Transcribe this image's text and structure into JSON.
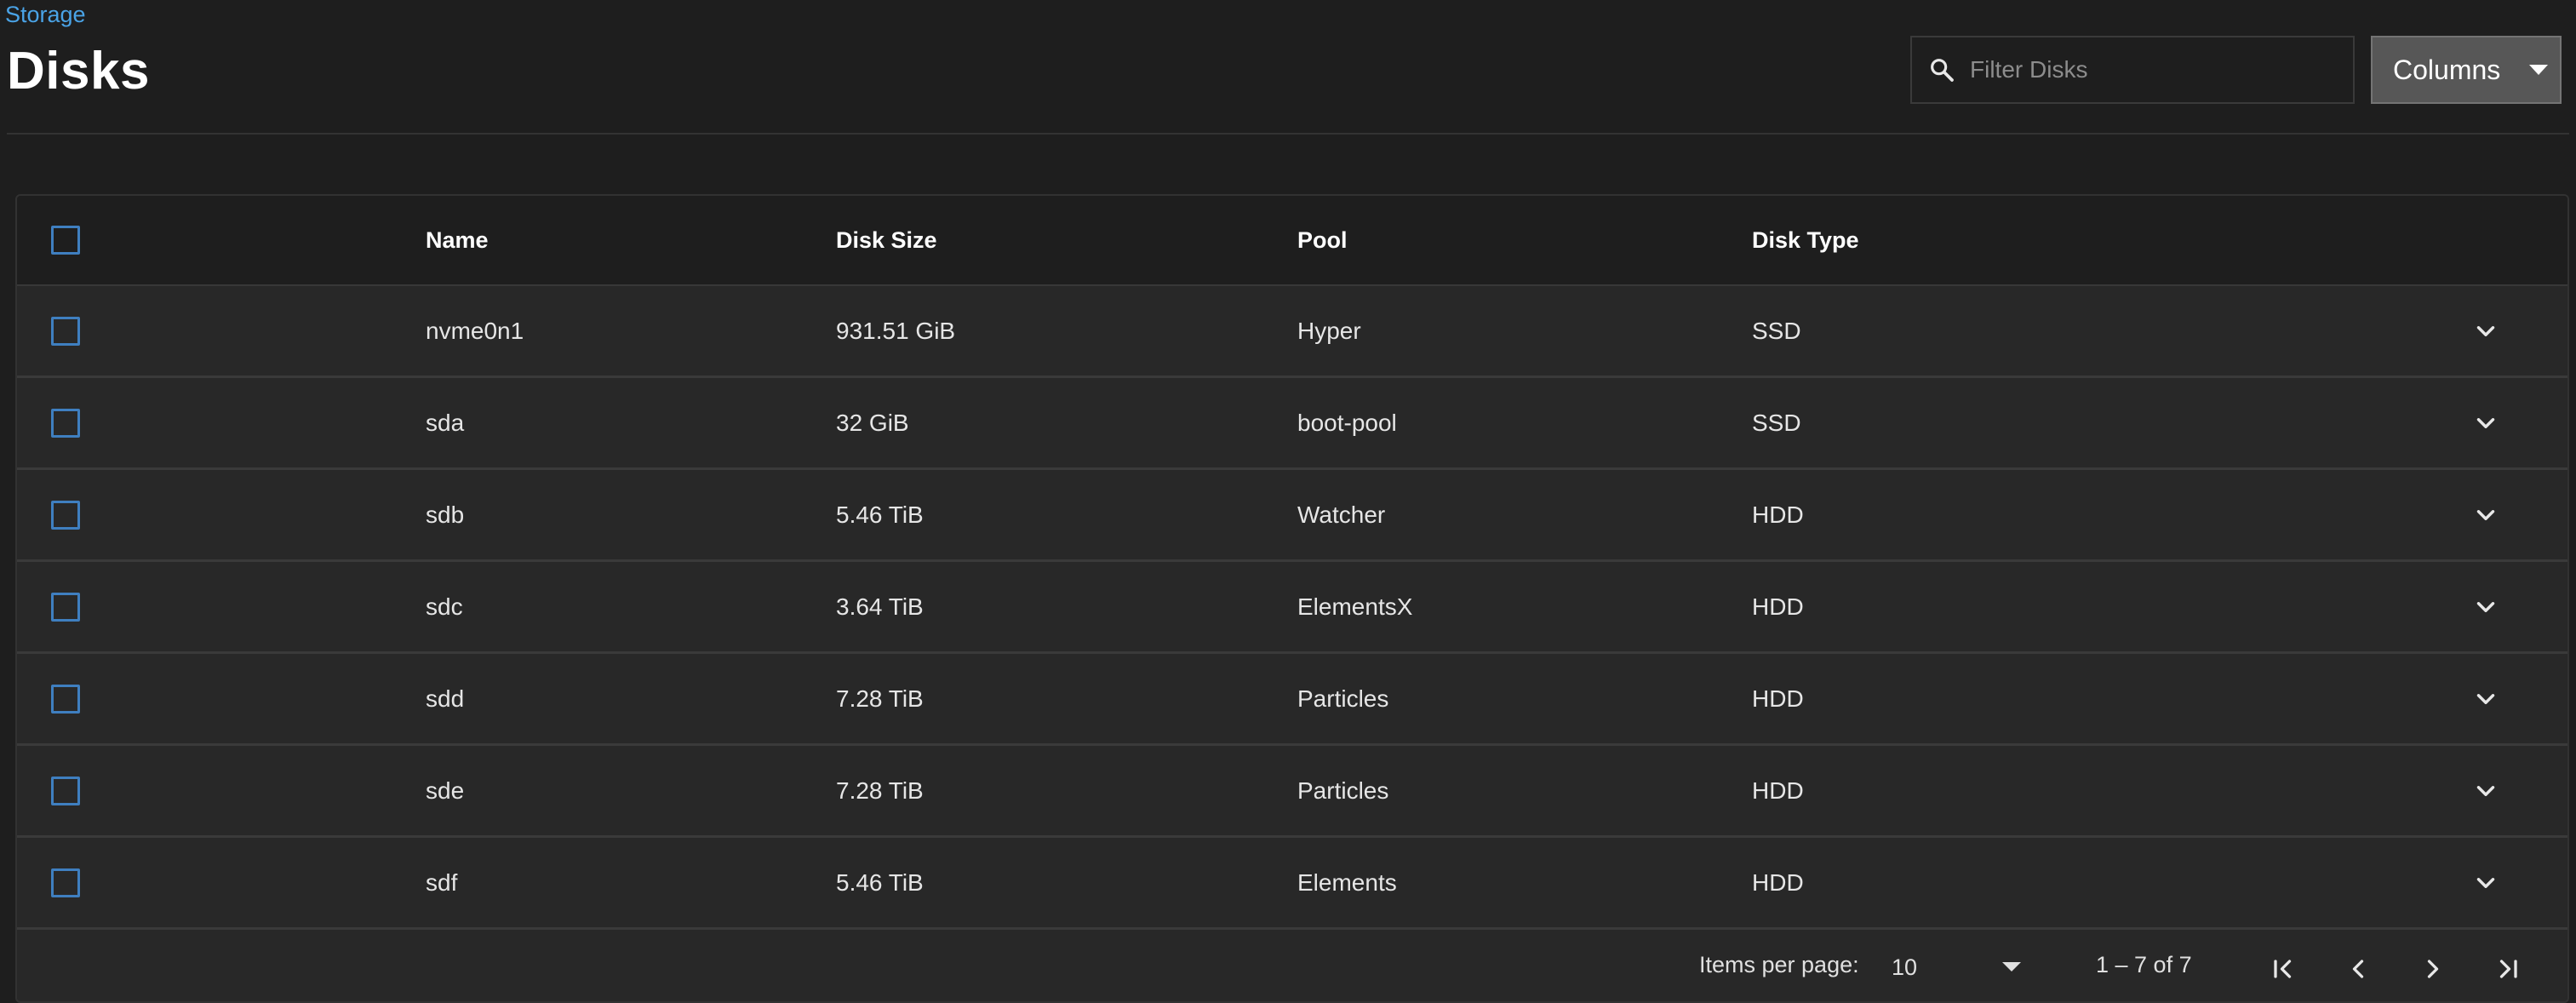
{
  "header": {
    "breadcrumb": "Storage",
    "title": "Disks",
    "filter_placeholder": "Filter Disks",
    "columns_label": "Columns"
  },
  "table": {
    "columns": [
      "Name",
      "Disk Size",
      "Pool",
      "Disk Type"
    ],
    "rows": [
      {
        "name": "nvme0n1",
        "size": "931.51 GiB",
        "pool": "Hyper",
        "type": "SSD"
      },
      {
        "name": "sda",
        "size": "32 GiB",
        "pool": "boot-pool",
        "type": "SSD"
      },
      {
        "name": "sdb",
        "size": "5.46 TiB",
        "pool": "Watcher",
        "type": "HDD"
      },
      {
        "name": "sdc",
        "size": "3.64 TiB",
        "pool": "ElementsX",
        "type": "HDD"
      },
      {
        "name": "sdd",
        "size": "7.28 TiB",
        "pool": "Particles",
        "type": "HDD"
      },
      {
        "name": "sde",
        "size": "7.28 TiB",
        "pool": "Particles",
        "type": "HDD"
      },
      {
        "name": "sdf",
        "size": "5.46 TiB",
        "pool": "Elements",
        "type": "HDD"
      }
    ]
  },
  "paginator": {
    "items_per_page_label": "Items per page:",
    "items_per_page_value": "10",
    "range_label": "1 – 7 of 7"
  },
  "icons": {
    "search": "search-icon",
    "expand": "chevron-down-icon",
    "first": "first-page-icon",
    "prev": "chevron-left-icon",
    "next": "chevron-right-icon",
    "last": "last-page-icon"
  },
  "colors": {
    "background": "#1e1e1e",
    "card": "#282828",
    "accent": "#4aa3e6",
    "checkbox_border": "#3f7fc0",
    "button": "#575757"
  }
}
